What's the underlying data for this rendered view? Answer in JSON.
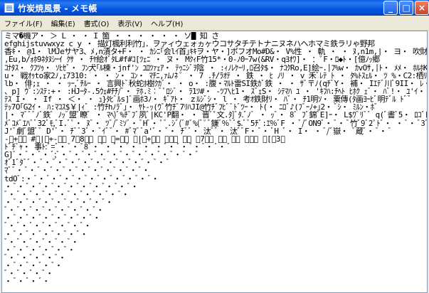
{
  "window": {
    "title": "竹炭焼風景 - メモ帳",
    "controls": {
      "minimize": "_",
      "maximize": "□",
      "close": "×"
    }
  },
  "menu": {
    "items": [
      "ファイル(F)",
      "編集(E)",
      "書式(O)",
      "表示(V)",
      "ヘルプ(H)"
    ]
  },
  "editor": {
    "lines": [
      "ミマ�機ア・ ＞ L ・ ・ I 箇 ・ ・ ・ ・ ・ ・ ソ█ 知 さ",
      "efghijstuvwxyz c y ・ 描灯楓利利竹」．ヲァィウェォヵヶウコサタチテトナニヌネハヘホマミ鉄ラリゃ野邦",
      "香ｷ・ @1・ lMJeサヤ3、ﾒ,n漬タ+F・ ・ ｶｼﾆ｢会lｲ首｣ｷｷヲ・ヤ・]ボフオMo#D&・ V%性 ・ 軌 ・ ・ ﾇ,n1m,|・ ヨ・ 吹財乗ｷ竹彡",
      ",Eu,b/ｫﾎ9ﾈﾀﾇｼｰｲ ｸｻ ・ ﾁﾔ絵ｵﾞﾀL#f#ｺ[ﾂｪﾆ ・ ヌ・ MｸｨF竹15*・0-ﾉ0ｰ7w(&RV・qﾖｵﾜ]・ ：ﾟF・ﾛ◆ﾄ・[億ﾉｯ郷",
      "ｺﾅﾀｽ・ ｸﾌﾂｩ・ ｿﾋｾﾞ・ ﾌﾝ犬｢ﾙ棟・jnf'ﾝ ﾕﾛﾂｧｪｱ・ ﾃｩﾆｼﾞｦ陰 ・ :ｨﾉﾚｹｰﾘ,ﾛ召ﾀ$・ ﾅｺｸRo,E]絵ｰ.│ﾌ%w・ ｶvOｻ,│ﾄ・ ﾒﾒ・ ﾎﾙﾎK/ｳｺ",
      "u・ 戦ｵｩto家2ﾉ,ｪ7310: ・ ・ ﾝ・ ｺﾝ・ ﾏﾁﾆ,ｧﾑﾉﾈ ﾟ ・ 7 .ﾁ/ﾗｵﾃ ・ 鉄 ・ ﾋ ﾉﾘ ・ v 禾ﾞﾚﾃ ﾄ ・ ﾀ%ﾄｽｪﾙ・ ﾂ %・C2:栖ﾘ ﾘﾝ,",
      "lb・ 俳;ｪ ・ ・ ｯｰ,ﾞﾁﾙｰ ・ 言興ﾄﾞ秋蛇ﾎ樹ｸｶﾞ・ ・ o・ :腹・ﾏﾙﾄ雷SI鉄ｶﾞ鉄 ・ ・ ｻﾞ〒ﾉ(qﾁﾞY・ 補・ Iｴﾃﾞ川ﾞ9II・ ﾚ・ 7 ﾁﾄﾄ",
      "、p] ｳﾞ:ﾝｽﾃ:+・ :HJｰﾀ-.5ｳｪ#ﾁﾁ/ﾞ・ ﾃﾎ.ﾐ︰ﾞﾟﾛｼﾞ・ ﾗ1ﾂ#・ -ﾂﾌ\\ﾋ1・ ｽﾞｪS・ ｼﾃﾏﾊ ﾕ ・ 'ｷﾌﾊ:ﾁﾍﾄ ﾋﾎｸ ｪﾞ・ ﾊﾞ!・ ﾕ'ｲ・・",
      "ﾃｽ I・ ・ If ・ ＜・ ・ ｭ}ﾀﾋﾞﾙs]ﾞ画ﾎ3ﾉ・ ｷﾞｱﾄ・ ｚﾙｼﾞｼ・ l ・ 考ｵ鉄財ﾘ・ ﾊﾞ・ ﾁ1明ｿ・ 粟傳(ﾀ画ﾖｰﾋﾞ明ﾃﾞﾙ ﾄﾞﾞ",
      "ﾃｯ7O｢G2ｲ・ ﾊ:ﾏｺｽ$￥|ｨﾞ :竹ﾁhﾉﾗﾞ」・ ﾔﾄ-ｯ(ｳﾞ竹ﾁﾞ7ﾘﾊJI@竹ﾁﾞﾌﾋﾞﾞﾄﾞﾂｰ・ ﾄ(・ ﾆﾛﾞ♪(ﾌﾞｰﾉ+｣2・ ﾞｼ・ ﾐﾙﾝ・ﾎﾞ",
      "|・ ﾏﾞﾞﾞﾉﾞ鉄ﾞ ﾉｯﾞ盟ﾞ瞭ﾞ ・ ﾏﾍ)ﾞ%ﾁﾞﾌﾞ夙ﾞ|KC'P翻・ ・ 晋ﾞﾟ文.ﾀ]ﾞﾀ.ﾞﾉﾞ ・ ｯﾞ・ 8ﾞ ﾌﾞ錦ﾞE]ｰ・ L$ﾜﾞﾘﾞﾞ q(ﾞ書ﾞ5・ ﾛｺﾞﾄﾞ",
      "ﾒﾞｺﾒﾞｴﾊﾞﾞ32ﾞﾓ,ﾞI.ﾞﾟ・ ﾇﾞ・ ﾂﾞ/ﾞﾐｿﾞ・ ﾞHﾞ・ ﾟﾞ.ｼﾞ(ﾞ#ﾞ%(ﾞﾟﾞ鎌ﾞ%ﾞﾞ$.ﾞﾞ5ﾁﾞ:ｴ%ﾞF ・ ﾞ/ﾞON9ﾞ・ ﾞ・ ﾞ竹ﾞ9ﾞ2ﾟﾄﾞ・ ・ ﾞ・ ﾞ3ﾞ・",
      "J'ﾞ劇ﾞ盟ﾞﾞ D'ﾞ・ ﾁﾞﾞ3ﾞ・ ﾞｲﾞﾞ・ #ﾞﾏﾞﾞa'ﾞ・ ﾞ・ ﾁﾞﾞ・ 汰ﾞﾞ・ 汰ﾞﾞF・ ﾞ・ ﾞH ﾞ・ I・ ・ ﾞ/ﾞ嶽・ ﾞ蔵ﾞ・ ﾞ・ ﾞ",
      "-ﾞ+ﾞ・ #ﾞ|ﾞ+-ﾞ・ 7ﾞ8ﾞ・ ﾞ・ ﾞ=ﾞ・ ﾞ|ﾞ+ﾞ・ ﾞﾞ・ ﾞ・ ﾞ7ﾞ・ ﾞ・ ﾞ・ ﾞﾞ・ ﾞ[ﾞ3ﾞ",
      "ﾄﾞﾁﾞｬ・ 事ﾄ:ﾞ=ﾞ・ ﾞ・ ﾞ8ﾞ・ ﾞ・ ﾞ・ ﾞ・ ﾞ・ ﾞ・ ﾞ・ ﾞ・ ﾞ・ ﾞ・ ﾞ・ ﾞ",
      "G]ﾞ・ ﾞ・ ﾞ・ ﾞ;ﾞ・ ﾞ・ ﾞ・ ﾞ・ ﾞ・ ﾞ・ ﾞ・ ﾞ・ ﾞ・ ﾞ・ ﾞ・ ﾞ",
      "ｵﾞ1ﾞﾀﾞﾞ・ ﾞ・ ﾞ・ ﾞ・ ﾞ・ ﾞ・ ﾞ・ ﾞ・ ﾞ・ ﾞ・ ﾞ・ ﾞ",
      "ﾏﾞﾞ・ ﾞ・ ﾞ・ ﾞ・ ﾞ・ ﾞ・ ﾞ・ ﾞ・ ﾞ・ ﾞ・ ﾞ・",
      "tdOﾞ:・ ﾞ・ ﾞ・ ﾞ・ ﾞ・ ﾞ・ ﾞ・ ﾞ・ ﾞ・ ﾞ・ ﾞ・",
      "・ ﾞ・ ﾞ・ ﾞ・ ﾞ・ ﾞ・ ﾞ・ ﾞ・ ﾞ・ ﾞ・ ﾞ・",
      "ﾞ・ ﾞ・ ﾞ・ ﾞ・ ﾞ・ ﾞ・ ﾞ・ ﾞ・ ﾞ・ ﾞ・",
      "・ ﾞ・ ﾞ・ ﾞ・ ﾞ・ ﾞ・ ﾞ・ ﾞ・ ﾞ・",
      "ﾞ・ ﾞ・ ﾞ・ ﾞ・ ﾞ・ ﾞ・ ﾞ・ ﾞ・",
      "・ ﾞ・ ﾞ・ ﾞ・ ﾞ・ ﾞ・ ﾞ・ ﾞ・",
      "ﾞ・ ﾞ・ ﾞ・ ﾞ・ ﾞ・ ﾞ・ ﾞ・",
      "・ ﾞ・ ﾞ・ ﾞ・ ﾞ・ ﾞ・ ﾞ・",
      "ﾞ・ ﾞ・ ﾞ・ ﾞ・ ﾞ・ ﾞ・",
      "・ ﾞ・ ﾞ・ ﾞ・ ﾞ・ ﾞ・",
      "ﾞ・ ﾞ・ ﾞ・ ﾞ・ ﾞ・",
      "・ ﾞ・ ﾞ・ ﾞ・ ﾞ・",
      "ﾞ・ ﾞ・ ﾞ・ ﾞ・",
      "・ ﾞ・ ﾞ・ ﾞ・"
    ]
  }
}
